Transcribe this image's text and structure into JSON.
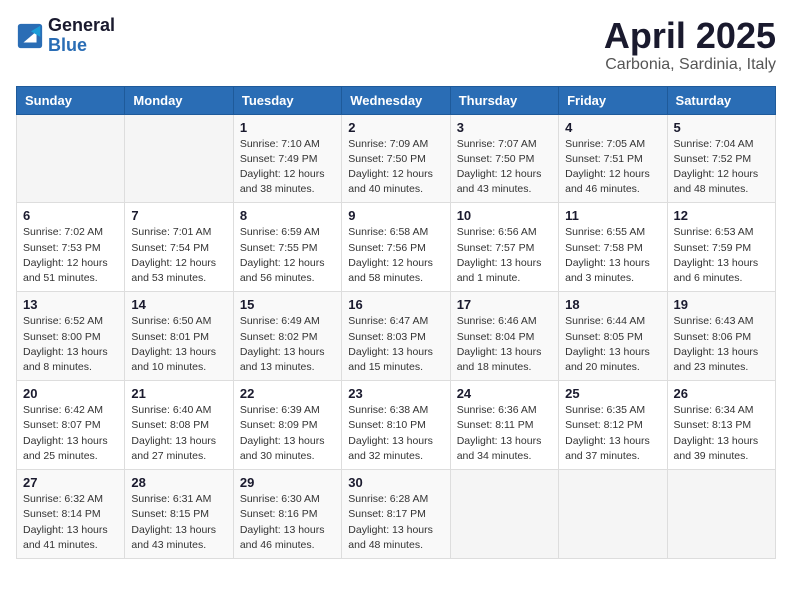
{
  "header": {
    "logo_general": "General",
    "logo_blue": "Blue",
    "month_title": "April 2025",
    "subtitle": "Carbonia, Sardinia, Italy"
  },
  "weekdays": [
    "Sunday",
    "Monday",
    "Tuesday",
    "Wednesday",
    "Thursday",
    "Friday",
    "Saturday"
  ],
  "weeks": [
    [
      {
        "day": "",
        "info": ""
      },
      {
        "day": "",
        "info": ""
      },
      {
        "day": "1",
        "info": "Sunrise: 7:10 AM\nSunset: 7:49 PM\nDaylight: 12 hours\nand 38 minutes."
      },
      {
        "day": "2",
        "info": "Sunrise: 7:09 AM\nSunset: 7:50 PM\nDaylight: 12 hours\nand 40 minutes."
      },
      {
        "day": "3",
        "info": "Sunrise: 7:07 AM\nSunset: 7:50 PM\nDaylight: 12 hours\nand 43 minutes."
      },
      {
        "day": "4",
        "info": "Sunrise: 7:05 AM\nSunset: 7:51 PM\nDaylight: 12 hours\nand 46 minutes."
      },
      {
        "day": "5",
        "info": "Sunrise: 7:04 AM\nSunset: 7:52 PM\nDaylight: 12 hours\nand 48 minutes."
      }
    ],
    [
      {
        "day": "6",
        "info": "Sunrise: 7:02 AM\nSunset: 7:53 PM\nDaylight: 12 hours\nand 51 minutes."
      },
      {
        "day": "7",
        "info": "Sunrise: 7:01 AM\nSunset: 7:54 PM\nDaylight: 12 hours\nand 53 minutes."
      },
      {
        "day": "8",
        "info": "Sunrise: 6:59 AM\nSunset: 7:55 PM\nDaylight: 12 hours\nand 56 minutes."
      },
      {
        "day": "9",
        "info": "Sunrise: 6:58 AM\nSunset: 7:56 PM\nDaylight: 12 hours\nand 58 minutes."
      },
      {
        "day": "10",
        "info": "Sunrise: 6:56 AM\nSunset: 7:57 PM\nDaylight: 13 hours\nand 1 minute."
      },
      {
        "day": "11",
        "info": "Sunrise: 6:55 AM\nSunset: 7:58 PM\nDaylight: 13 hours\nand 3 minutes."
      },
      {
        "day": "12",
        "info": "Sunrise: 6:53 AM\nSunset: 7:59 PM\nDaylight: 13 hours\nand 6 minutes."
      }
    ],
    [
      {
        "day": "13",
        "info": "Sunrise: 6:52 AM\nSunset: 8:00 PM\nDaylight: 13 hours\nand 8 minutes."
      },
      {
        "day": "14",
        "info": "Sunrise: 6:50 AM\nSunset: 8:01 PM\nDaylight: 13 hours\nand 10 minutes."
      },
      {
        "day": "15",
        "info": "Sunrise: 6:49 AM\nSunset: 8:02 PM\nDaylight: 13 hours\nand 13 minutes."
      },
      {
        "day": "16",
        "info": "Sunrise: 6:47 AM\nSunset: 8:03 PM\nDaylight: 13 hours\nand 15 minutes."
      },
      {
        "day": "17",
        "info": "Sunrise: 6:46 AM\nSunset: 8:04 PM\nDaylight: 13 hours\nand 18 minutes."
      },
      {
        "day": "18",
        "info": "Sunrise: 6:44 AM\nSunset: 8:05 PM\nDaylight: 13 hours\nand 20 minutes."
      },
      {
        "day": "19",
        "info": "Sunrise: 6:43 AM\nSunset: 8:06 PM\nDaylight: 13 hours\nand 23 minutes."
      }
    ],
    [
      {
        "day": "20",
        "info": "Sunrise: 6:42 AM\nSunset: 8:07 PM\nDaylight: 13 hours\nand 25 minutes."
      },
      {
        "day": "21",
        "info": "Sunrise: 6:40 AM\nSunset: 8:08 PM\nDaylight: 13 hours\nand 27 minutes."
      },
      {
        "day": "22",
        "info": "Sunrise: 6:39 AM\nSunset: 8:09 PM\nDaylight: 13 hours\nand 30 minutes."
      },
      {
        "day": "23",
        "info": "Sunrise: 6:38 AM\nSunset: 8:10 PM\nDaylight: 13 hours\nand 32 minutes."
      },
      {
        "day": "24",
        "info": "Sunrise: 6:36 AM\nSunset: 8:11 PM\nDaylight: 13 hours\nand 34 minutes."
      },
      {
        "day": "25",
        "info": "Sunrise: 6:35 AM\nSunset: 8:12 PM\nDaylight: 13 hours\nand 37 minutes."
      },
      {
        "day": "26",
        "info": "Sunrise: 6:34 AM\nSunset: 8:13 PM\nDaylight: 13 hours\nand 39 minutes."
      }
    ],
    [
      {
        "day": "27",
        "info": "Sunrise: 6:32 AM\nSunset: 8:14 PM\nDaylight: 13 hours\nand 41 minutes."
      },
      {
        "day": "28",
        "info": "Sunrise: 6:31 AM\nSunset: 8:15 PM\nDaylight: 13 hours\nand 43 minutes."
      },
      {
        "day": "29",
        "info": "Sunrise: 6:30 AM\nSunset: 8:16 PM\nDaylight: 13 hours\nand 46 minutes."
      },
      {
        "day": "30",
        "info": "Sunrise: 6:28 AM\nSunset: 8:17 PM\nDaylight: 13 hours\nand 48 minutes."
      },
      {
        "day": "",
        "info": ""
      },
      {
        "day": "",
        "info": ""
      },
      {
        "day": "",
        "info": ""
      }
    ]
  ]
}
